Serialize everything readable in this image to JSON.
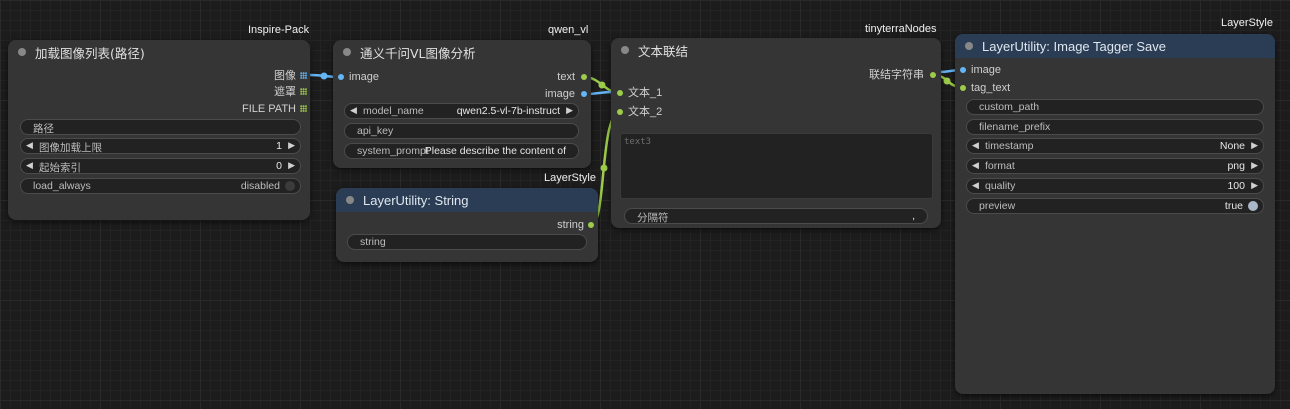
{
  "groups": {
    "inspire_pack": "Inspire-Pack",
    "qwen_vl": "qwen_vl",
    "tinyterra": "tinyterraNodes",
    "layerstyle_save": "LayerStyle",
    "layerstyle_string": "LayerStyle"
  },
  "node_load": {
    "title": "加载图像列表(路径)",
    "outputs": [
      "图像",
      "遮罩",
      "FILE PATH"
    ],
    "widgets": {
      "path": "路径",
      "max_label": "图像加载上限",
      "max_value": "1",
      "start_label": "起始索引",
      "start_value": "0",
      "load_always_label": "load_always",
      "load_always_value": "disabled"
    }
  },
  "node_qwen": {
    "title": "通义千问VL图像分析",
    "input_image": "image",
    "output_text": "text",
    "output_image": "image",
    "model_label": "model_name",
    "model_value": "qwen2.5-vl-7b-instruct",
    "api_key": "api_key",
    "system_prompt_label": "system_prompt",
    "system_prompt_value": "Please describe the content of"
  },
  "node_string": {
    "title": "LayerUtility: String",
    "output": "string",
    "widget": "string"
  },
  "node_concat": {
    "title": "文本联结",
    "input1": "文本_1",
    "input2": "文本_2",
    "output": "联结字符串",
    "placeholder": "text3",
    "delimiter_label": "分隔符",
    "delimiter_value": ","
  },
  "node_save": {
    "title": "LayerUtility: Image Tagger Save",
    "input_image": "image",
    "input_tag": "tag_text",
    "custom_path": "custom_path",
    "filename_prefix": "filename_prefix",
    "timestamp_label": "timestamp",
    "timestamp_value": "None",
    "format_label": "format",
    "format_value": "png",
    "quality_label": "quality",
    "quality_value": "100",
    "preview_label": "preview",
    "preview_value": "true"
  },
  "colors": {
    "image_link": "#64b5f6",
    "string_link": "#9ccc4a",
    "blue_header": "#2b3d55"
  }
}
